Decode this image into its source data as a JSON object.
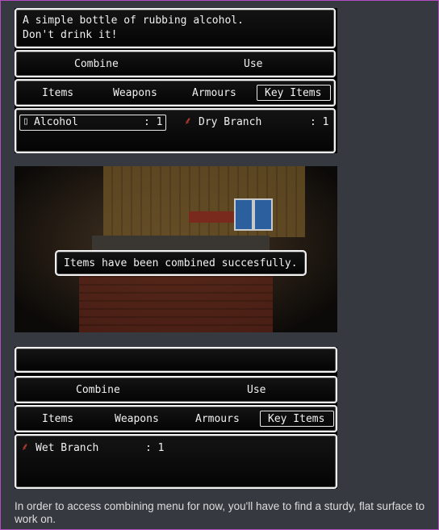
{
  "screen1": {
    "description": [
      "A simple bottle of rubbing alcohol.",
      "Don't drink it!"
    ],
    "commands": {
      "combine": "Combine",
      "use": "Use"
    },
    "tabs": {
      "items": "Items",
      "weapons": "Weapons",
      "armours": "Armours",
      "key_items": "Key Items"
    },
    "inventory": [
      {
        "name": "Alcohol",
        "qty": ": 1",
        "icon": "bottle-icon"
      },
      {
        "name": "Dry Branch",
        "qty": ": 1",
        "icon": "branch-icon"
      }
    ]
  },
  "screen2": {
    "message": "Items have been combined succesfully."
  },
  "screen3": {
    "commands": {
      "combine": "Combine",
      "use": "Use"
    },
    "tabs": {
      "items": "Items",
      "weapons": "Weapons",
      "armours": "Armours",
      "key_items": "Key Items"
    },
    "inventory": [
      {
        "name": "Wet Branch",
        "qty": ": 1",
        "icon": "branch-icon"
      }
    ]
  },
  "caption": "In order to access combining menu for now, you'll have to find a sturdy, flat surface to work on.",
  "colors": {
    "background": "#36393f",
    "window_border": "#f2f2f2",
    "branch_icon": "#d0443a"
  }
}
